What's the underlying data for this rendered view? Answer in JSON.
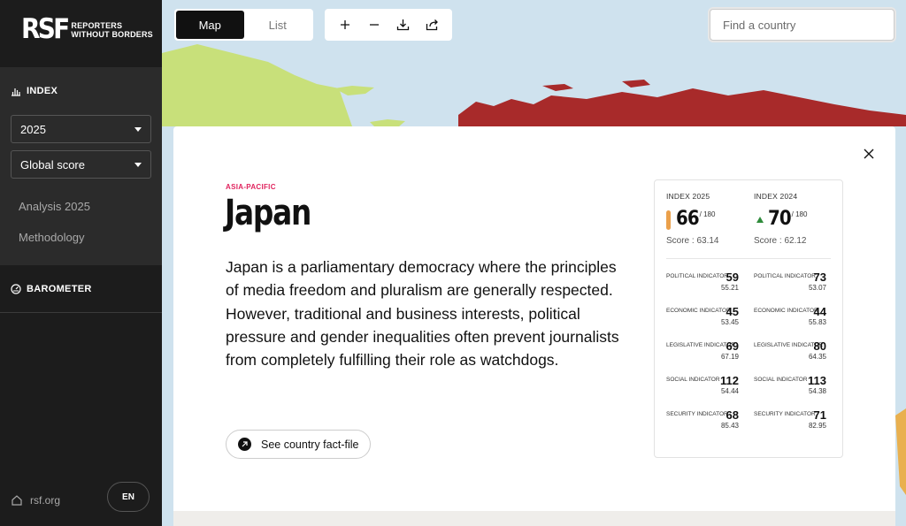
{
  "sidebar": {
    "logo_mark": "RSF",
    "logo_line1": "REPORTERS",
    "logo_line2": "WITHOUT BORDERS",
    "index_label": "INDEX",
    "year_select": "2025",
    "score_select": "Global score",
    "links": [
      "Analysis 2025",
      "Methodology"
    ],
    "barometer_label": "BAROMETER",
    "footer_link": "rsf.org",
    "language": "EN"
  },
  "map": {
    "view_toggle": {
      "map": "Map",
      "list": "List",
      "active": "map"
    },
    "tools": [
      "plus-icon",
      "minus-icon",
      "download-icon",
      "share-icon"
    ],
    "search_placeholder": "Find a country"
  },
  "country": {
    "region": "ASIA-PACIFIC",
    "name": "Japan",
    "description": "Japan is a parliamentary democracy where the principles of media freedom and pluralism are generally respected. However, traditional and business interests, political pressure and gender inequalities often prevent journalists from completely fulfilling their role as watchdogs.",
    "fact_file_label": "See country fact-file"
  },
  "scores": {
    "out_of": "/ 180",
    "index_2025": {
      "label": "INDEX 2025",
      "rank": "66",
      "score": "Score : 63.14",
      "indicator_color": "#eba04b",
      "indicators": [
        {
          "label": "POLITICAL INDICATOR",
          "rank": "59",
          "score": "55.21"
        },
        {
          "label": "ECONOMIC INDICATOR",
          "rank": "45",
          "score": "53.45"
        },
        {
          "label": "LEGISLATIVE INDICATOR",
          "rank": "69",
          "score": "67.19"
        },
        {
          "label": "SOCIAL INDICATOR",
          "rank": "112",
          "score": "54.44"
        },
        {
          "label": "SECURITY INDICATOR",
          "rank": "68",
          "score": "85.43"
        }
      ]
    },
    "index_2024": {
      "label": "INDEX 2024",
      "rank": "70",
      "trend": "up",
      "score": "Score : 62.12",
      "indicators": [
        {
          "label": "POLITICAL INDICATOR",
          "rank": "73",
          "score": "53.07"
        },
        {
          "label": "ECONOMIC INDICATOR",
          "rank": "44",
          "score": "55.83"
        },
        {
          "label": "LEGISLATIVE INDICATOR",
          "rank": "80",
          "score": "64.35"
        },
        {
          "label": "SOCIAL INDICATOR",
          "rank": "113",
          "score": "54.38"
        },
        {
          "label": "SECURITY INDICATOR",
          "rank": "71",
          "score": "82.95"
        }
      ]
    }
  },
  "colors": {
    "sidebar_bg": "#1c1c1c",
    "sea": "#cfe2ee",
    "land_green": "#c8e07a",
    "land_red": "#a82a2a",
    "region_accent": "#e0245e",
    "trend_up": "#2e8b3a"
  }
}
